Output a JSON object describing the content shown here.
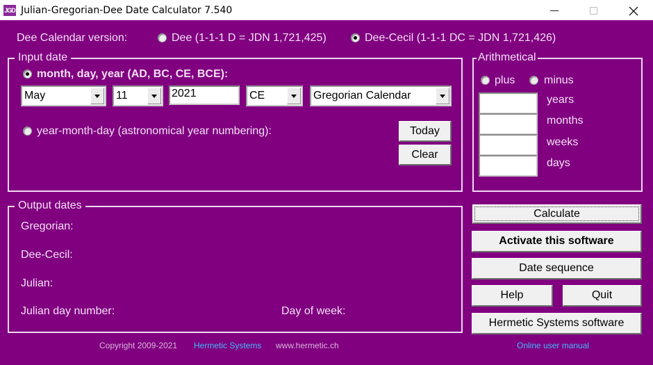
{
  "window": {
    "icon_text": "JGD",
    "title": "Julian-Gregorian-Dee Date Calculator 7.540"
  },
  "dee_version": {
    "label": "Dee Calendar version:",
    "options": [
      {
        "label": "Dee (1-1-1 D = JDN 1,721,425)",
        "checked": false
      },
      {
        "label": "Dee-Cecil (1-1-1 DC = JDN 1,721,426)",
        "checked": true
      }
    ]
  },
  "input_date": {
    "legend": "Input date",
    "mdy_radio": {
      "label": "month, day, year (AD, BC, CE, BCE):",
      "checked": true
    },
    "month": "May",
    "day": "11",
    "year": "2021",
    "era": "CE",
    "calendar": "Gregorian Calendar",
    "ymd_radio": {
      "label": "year-month-day (astronomical year numbering):",
      "checked": false
    },
    "today_label": "Today",
    "clear_label": "Clear"
  },
  "arithmetical": {
    "legend": "Arithmetical",
    "plus_label": "plus",
    "minus_label": "minus",
    "fields": [
      {
        "label": "years",
        "value": ""
      },
      {
        "label": "months",
        "value": ""
      },
      {
        "label": "weeks",
        "value": ""
      },
      {
        "label": "days",
        "value": ""
      }
    ]
  },
  "output_dates": {
    "legend": "Output dates",
    "gregorian_label": "Gregorian:",
    "dee_cecil_label": "Dee-Cecil:",
    "julian_label": "Julian:",
    "jdn_label": "Julian day number:",
    "dow_label": "Day of week:"
  },
  "actions": {
    "calculate": "Calculate",
    "activate": "Activate this software",
    "date_sequence": "Date sequence",
    "help": "Help",
    "quit": "Quit",
    "hermetic_software": "Hermetic Systems software",
    "online_manual": "Online user manual"
  },
  "footer": {
    "copyright": "Copyright 2009-2021",
    "company_link": "Hermetic Systems",
    "website": "www.hermetic.ch"
  },
  "colors": {
    "background": "#800080",
    "link": "#47b8ff",
    "label": "#f4e0f4"
  }
}
